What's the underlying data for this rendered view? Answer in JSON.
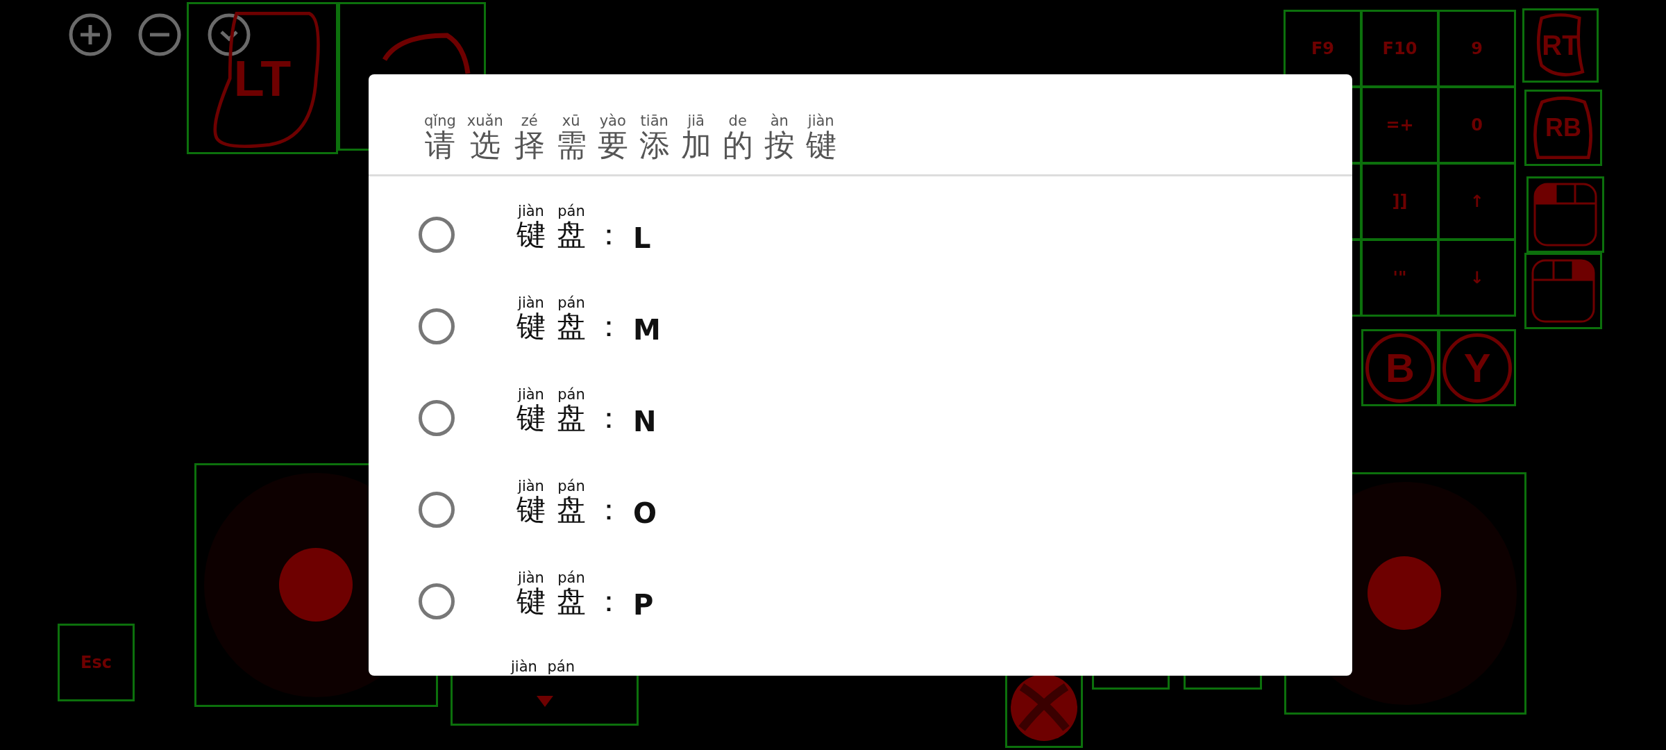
{
  "overlay": {
    "triggers": [
      {
        "label": "LT"
      },
      {
        "label": "RT"
      },
      {
        "label": "RB"
      }
    ],
    "grid": [
      {
        "cells": [
          "F9",
          "F10",
          "9"
        ]
      },
      {
        "cells": [
          "=+",
          "0"
        ]
      },
      {
        "cells": [
          "]]",
          "↑"
        ]
      },
      {
        "cells": [
          "'\"",
          "↓"
        ]
      }
    ],
    "face_buttons": [
      "B",
      "Y"
    ],
    "esc": "Esc"
  },
  "dialog": {
    "title": [
      {
        "hanzi": "请",
        "pinyin": "qǐng"
      },
      {
        "hanzi": "选",
        "pinyin": "xuǎn"
      },
      {
        "hanzi": "择",
        "pinyin": "zé"
      },
      {
        "hanzi": "需",
        "pinyin": "xū"
      },
      {
        "hanzi": "要",
        "pinyin": "yào"
      },
      {
        "hanzi": "添",
        "pinyin": "tiān"
      },
      {
        "hanzi": "加",
        "pinyin": "jiā"
      },
      {
        "hanzi": "的",
        "pinyin": "de"
      },
      {
        "hanzi": "按",
        "pinyin": "àn"
      },
      {
        "hanzi": "键",
        "pinyin": "jiàn"
      }
    ],
    "options": [
      {
        "chars": [
          {
            "hanzi": "键",
            "pinyin": "jiàn"
          },
          {
            "hanzi": "盘",
            "pinyin": "pán"
          }
        ],
        "suffix": "：",
        "key": "L",
        "selected": false
      },
      {
        "chars": [
          {
            "hanzi": "键",
            "pinyin": "jiàn"
          },
          {
            "hanzi": "盘",
            "pinyin": "pán"
          }
        ],
        "suffix": "：",
        "key": "M",
        "selected": false
      },
      {
        "chars": [
          {
            "hanzi": "键",
            "pinyin": "jiàn"
          },
          {
            "hanzi": "盘",
            "pinyin": "pán"
          }
        ],
        "suffix": "：",
        "key": "N",
        "selected": false
      },
      {
        "chars": [
          {
            "hanzi": "键",
            "pinyin": "jiàn"
          },
          {
            "hanzi": "盘",
            "pinyin": "pán"
          }
        ],
        "suffix": "：",
        "key": "O",
        "selected": false
      },
      {
        "chars": [
          {
            "hanzi": "键",
            "pinyin": "jiàn"
          },
          {
            "hanzi": "盘",
            "pinyin": "pán"
          }
        ],
        "suffix": "：",
        "key": "P",
        "selected": false
      }
    ],
    "cut_row_pinyin": [
      "jiàn",
      "pán"
    ]
  }
}
